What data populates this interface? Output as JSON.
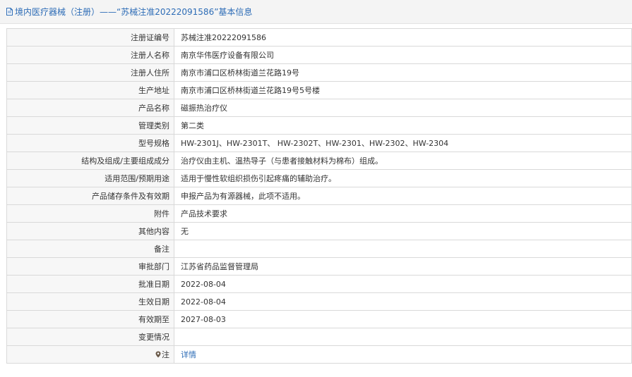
{
  "header": {
    "title": "境内医疗器械（注册）——“苏械注准20222091586”基本信息",
    "icon": "document-icon",
    "color": "#2d6cb6"
  },
  "rows": [
    {
      "label": "注册证编号",
      "value": "苏械注准20222091586"
    },
    {
      "label": "注册人名称",
      "value": "南京华伟医疗设备有限公司"
    },
    {
      "label": "注册人住所",
      "value": "南京市浦口区桥林街道兰花路19号"
    },
    {
      "label": "生产地址",
      "value": "南京市浦口区桥林街道兰花路19号5号楼"
    },
    {
      "label": "产品名称",
      "value": "磁振热治疗仪"
    },
    {
      "label": "管理类别",
      "value": "第二类"
    },
    {
      "label": "型号规格",
      "value": "HW-2301J、HW-2301T、 HW-2302T、HW-2301、HW-2302、HW-2304"
    },
    {
      "label": "结构及组成/主要组成成分",
      "value": "治疗仪由主机、温热导子（与患者接触材料为棉布）组成。"
    },
    {
      "label": "适用范围/预期用途",
      "value": "适用于慢性软组织损伤引起疼痛的辅助治疗。"
    },
    {
      "label": "产品储存条件及有效期",
      "value": "申报产品为有源器械，此项不适用。"
    },
    {
      "label": "附件",
      "value": "产品技术要求"
    },
    {
      "label": "其他内容",
      "value": "无"
    },
    {
      "label": "备注",
      "value": ""
    },
    {
      "label": "审批部门",
      "value": "江苏省药品监督管理局"
    },
    {
      "label": "批准日期",
      "value": "2022-08-04"
    },
    {
      "label": "生效日期",
      "value": "2022-08-04"
    },
    {
      "label": "有效期至",
      "value": "2027-08-03"
    },
    {
      "label": "变更情况",
      "value": ""
    }
  ],
  "note_row": {
    "icon": "map-pin-icon",
    "label": "注",
    "link_text": "详情"
  }
}
